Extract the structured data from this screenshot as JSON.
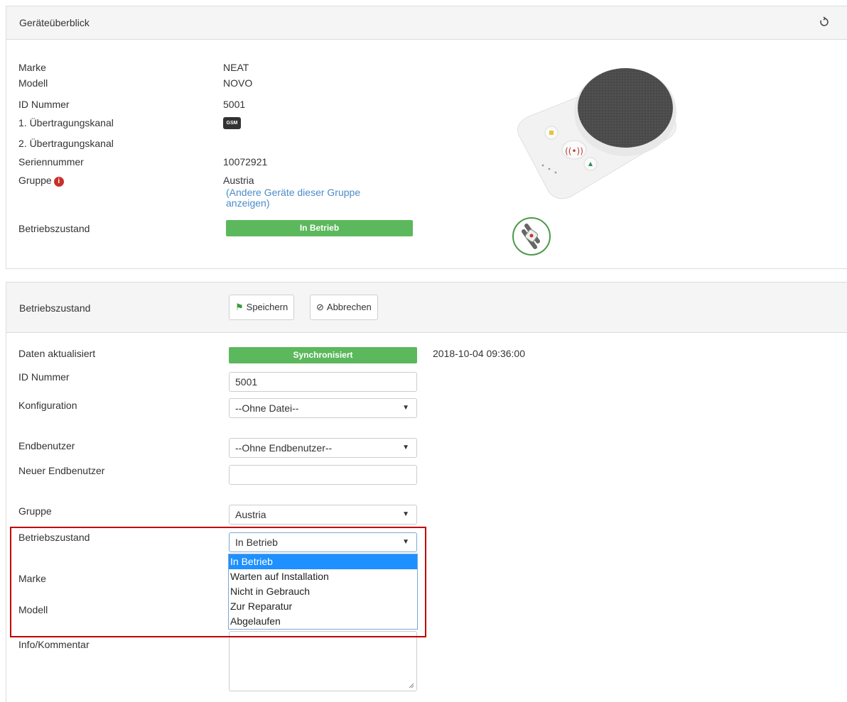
{
  "overview": {
    "title": "Geräteüberblick",
    "refresh_icon": "refresh-icon",
    "rows": {
      "marke_label": "Marke",
      "marke_value": "NEAT",
      "modell_label": "Modell",
      "modell_value": "NOVO",
      "id_label": "ID Nummer",
      "id_value": "5001",
      "kanal1_label": "1. Übertragungskanal",
      "kanal1_badge": "GSM",
      "kanal2_label": "2. Übertragungskanal",
      "serien_label": "Seriennummer",
      "serien_value": "10072921",
      "gruppe_label": "Gruppe",
      "gruppe_value": "Austria",
      "gruppe_link": "(Andere Geräte dieser Gruppe anzeigen)",
      "betrieb_label": "Betriebszustand",
      "betrieb_status": "In Betrieb"
    }
  },
  "editor": {
    "title": "Betriebszustand",
    "save_label": "Speichern",
    "cancel_label": "Abbrechen",
    "fields": {
      "daten_label": "Daten aktualisiert",
      "daten_status": "Synchronisiert",
      "daten_timestamp": "2018-10-04 09:36:00",
      "id_label": "ID Nummer",
      "id_value": "5001",
      "konfig_label": "Konfiguration",
      "konfig_value": "--Ohne Datei--",
      "endbenutzer_label": "Endbenutzer",
      "endbenutzer_value": "--Ohne Endbenutzer--",
      "neuer_label": "Neuer Endbenutzer",
      "neuer_value": "",
      "gruppe_label": "Gruppe",
      "gruppe_value": "Austria",
      "betrieb_label": "Betriebszustand",
      "betrieb_value": "In Betrieb",
      "marke_label": "Marke",
      "modell_label": "Modell",
      "info_label": "Info/Kommentar"
    },
    "betrieb_options": [
      "In Betrieb",
      "Warten auf Installation",
      "Nicht in Gebrauch",
      "Zur Reparatur",
      "Abgelaufen"
    ],
    "betrieb_selected_index": 0
  },
  "colors": {
    "success": "#5cb85c",
    "link": "#4a8cc9",
    "highlight_border": "#c00000",
    "dropdown_selected": "#1e90ff"
  }
}
